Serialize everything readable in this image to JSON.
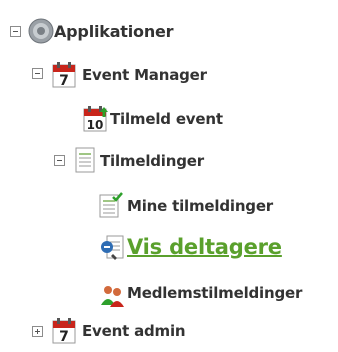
{
  "tree": {
    "root": {
      "label": "Applikationer",
      "icon": "gear-globe-icon"
    },
    "event_manager": {
      "label": "Event Manager",
      "icon": "calendar-7-icon"
    },
    "tilmeld_event": {
      "label": "Tilmeld event",
      "icon": "calendar-10-icon"
    },
    "tilmeldinger": {
      "label": "Tilmeldinger",
      "icon": "document-icon"
    },
    "mine_tilmeldinger": {
      "label": "Mine tilmeldinger",
      "icon": "document-check-icon"
    },
    "vis_deltagere": {
      "label": "Vis deltagere",
      "icon": "participants-icon"
    },
    "medlemstilmeldinger": {
      "label": "Medlemstilmeldinger",
      "icon": "members-icon"
    },
    "event_admin": {
      "label": "Event admin",
      "icon": "calendar-7-icon"
    }
  },
  "colors": {
    "link": "#5aa02c",
    "text": "#333333",
    "calendar_red": "#c8251b"
  }
}
